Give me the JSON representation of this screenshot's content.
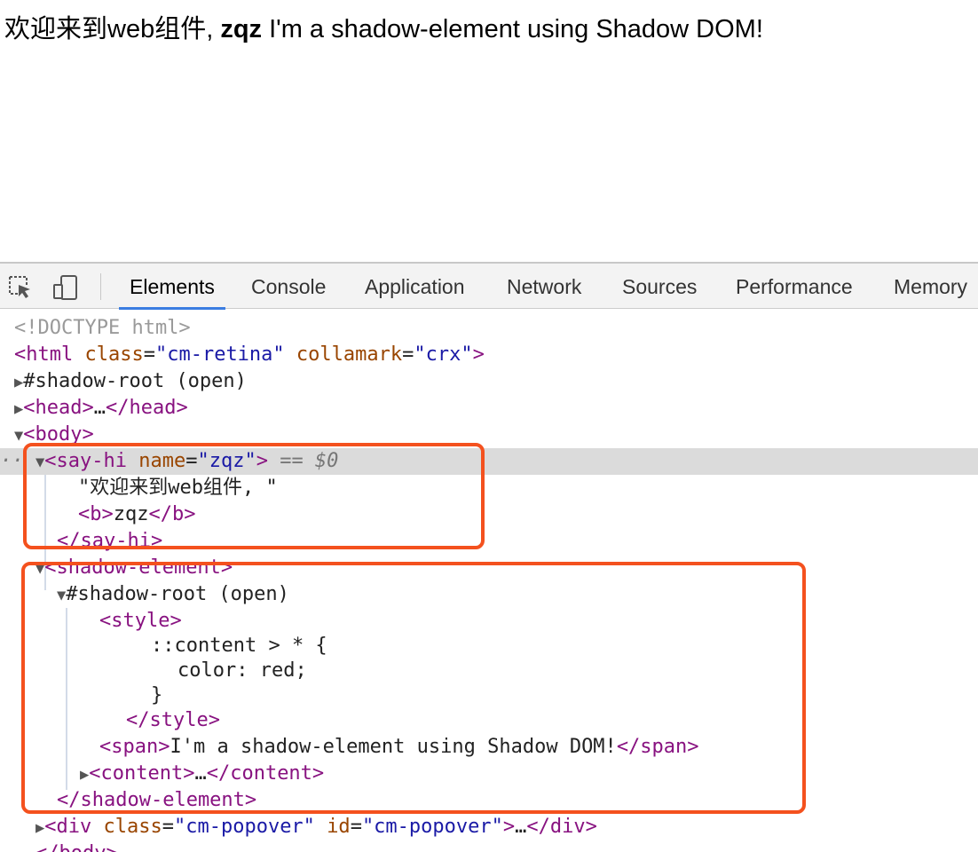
{
  "page": {
    "prefix": "欢迎来到web组件, ",
    "name": "zqz",
    "suffix": " I'm a shadow-element using Shadow DOM!"
  },
  "devtools": {
    "icons": [
      "inspect-cursor-icon",
      "device-toolbar-icon"
    ],
    "tabs": [
      "Elements",
      "Console",
      "Application",
      "Network",
      "Sources",
      "Performance",
      "Memory"
    ],
    "active_tab": "Elements",
    "accent": "#3b7de1",
    "highlight_color": "#f4511e"
  },
  "dom": {
    "doctype": "<!DOCTYPE html>",
    "html_open": {
      "lt": "<",
      "tag": "html",
      "a1n": "class",
      "a1v": "\"cm-retina\"",
      "a2n": "collamark",
      "a2v": "\"crx\"",
      "gt": ">"
    },
    "shadow_root_1": "#shadow-root (open)",
    "head": {
      "open": "<head>",
      "ellipsis": "…",
      "close": "</head>"
    },
    "body_open": "<body>",
    "say_hi": {
      "lt": "<",
      "tag": "say-hi",
      "an": "name",
      "av": "\"zqz\"",
      "gt": ">",
      "marker": " == $0"
    },
    "say_hi_text": "\"欢迎来到web组件, \"",
    "say_hi_b": {
      "open": "<b>",
      "text": "zqz",
      "close": "</b>"
    },
    "say_hi_close": "</say-hi>",
    "shadow_el_open": "<shadow-element>",
    "shadow_root_2": "#shadow-root (open)",
    "style_open": "<style>",
    "css_1": "::content > * {",
    "css_2": "color: red;",
    "css_3": "}",
    "style_close": "</style>",
    "span": {
      "open": "<span>",
      "text": "I'm a shadow-element using Shadow DOM!",
      "close": "</span>"
    },
    "content": {
      "open": "<content>",
      "ellipsis": "…",
      "close": "</content>"
    },
    "shadow_el_close": "</shadow-element>",
    "div": {
      "lt": "<",
      "tag": "div",
      "a1n": "class",
      "a1v": "\"cm-popover\"",
      "a2n": "id",
      "a2v": "\"cm-popover\"",
      "gt": ">",
      "ellipsis": "…",
      "close": "</div>"
    },
    "body_close": "</body>"
  }
}
